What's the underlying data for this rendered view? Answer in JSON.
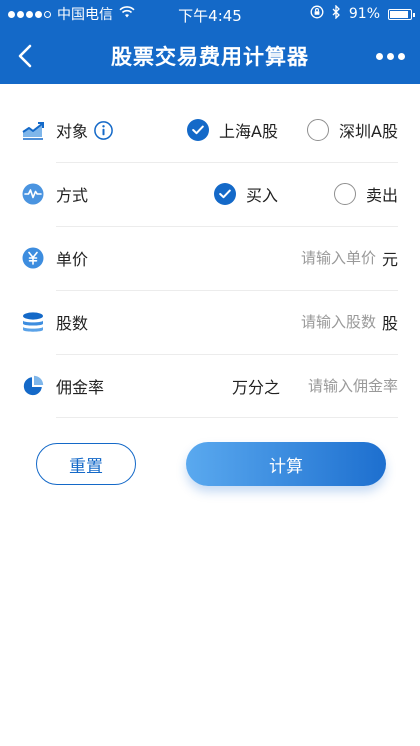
{
  "status_bar": {
    "carrier": "中国电信",
    "time": "下午4:45",
    "battery_percent": "91%",
    "battery_level": 0.91,
    "icons": [
      "signal-dots-icon",
      "wifi-icon",
      "orientation-lock-icon",
      "bluetooth-icon",
      "battery-icon"
    ]
  },
  "navbar": {
    "title": "股票交易费用计算器",
    "back_icon": "chevron-left-icon",
    "more_icon": "more-dots-icon"
  },
  "form": {
    "target": {
      "label": "对象",
      "icon": "trend-chart-icon",
      "info_icon": "info-icon",
      "options": [
        {
          "label": "上海A股",
          "checked": true
        },
        {
          "label": "深圳A股",
          "checked": false
        }
      ]
    },
    "mode": {
      "label": "方式",
      "icon": "wave-icon",
      "options": [
        {
          "label": "买入",
          "checked": true
        },
        {
          "label": "卖出",
          "checked": false
        }
      ]
    },
    "price": {
      "label": "单价",
      "icon": "yen-icon",
      "placeholder": "请输入单价",
      "value": "",
      "unit": "元"
    },
    "shares": {
      "label": "股数",
      "icon": "coin-stack-icon",
      "placeholder": "请输入股数",
      "value": "",
      "unit": "股"
    },
    "commission": {
      "label": "佣金率",
      "icon": "pie-chart-icon",
      "prefix": "万分之",
      "placeholder": "请输入佣金率",
      "value": ""
    }
  },
  "buttons": {
    "reset_label": "重置",
    "calculate_label": "计算"
  },
  "colors": {
    "primary": "#1469c8",
    "gradient_start": "#5aa9ef",
    "gradient_end": "#1d6fcf",
    "divider": "#ececec",
    "placeholder": "#999999"
  }
}
